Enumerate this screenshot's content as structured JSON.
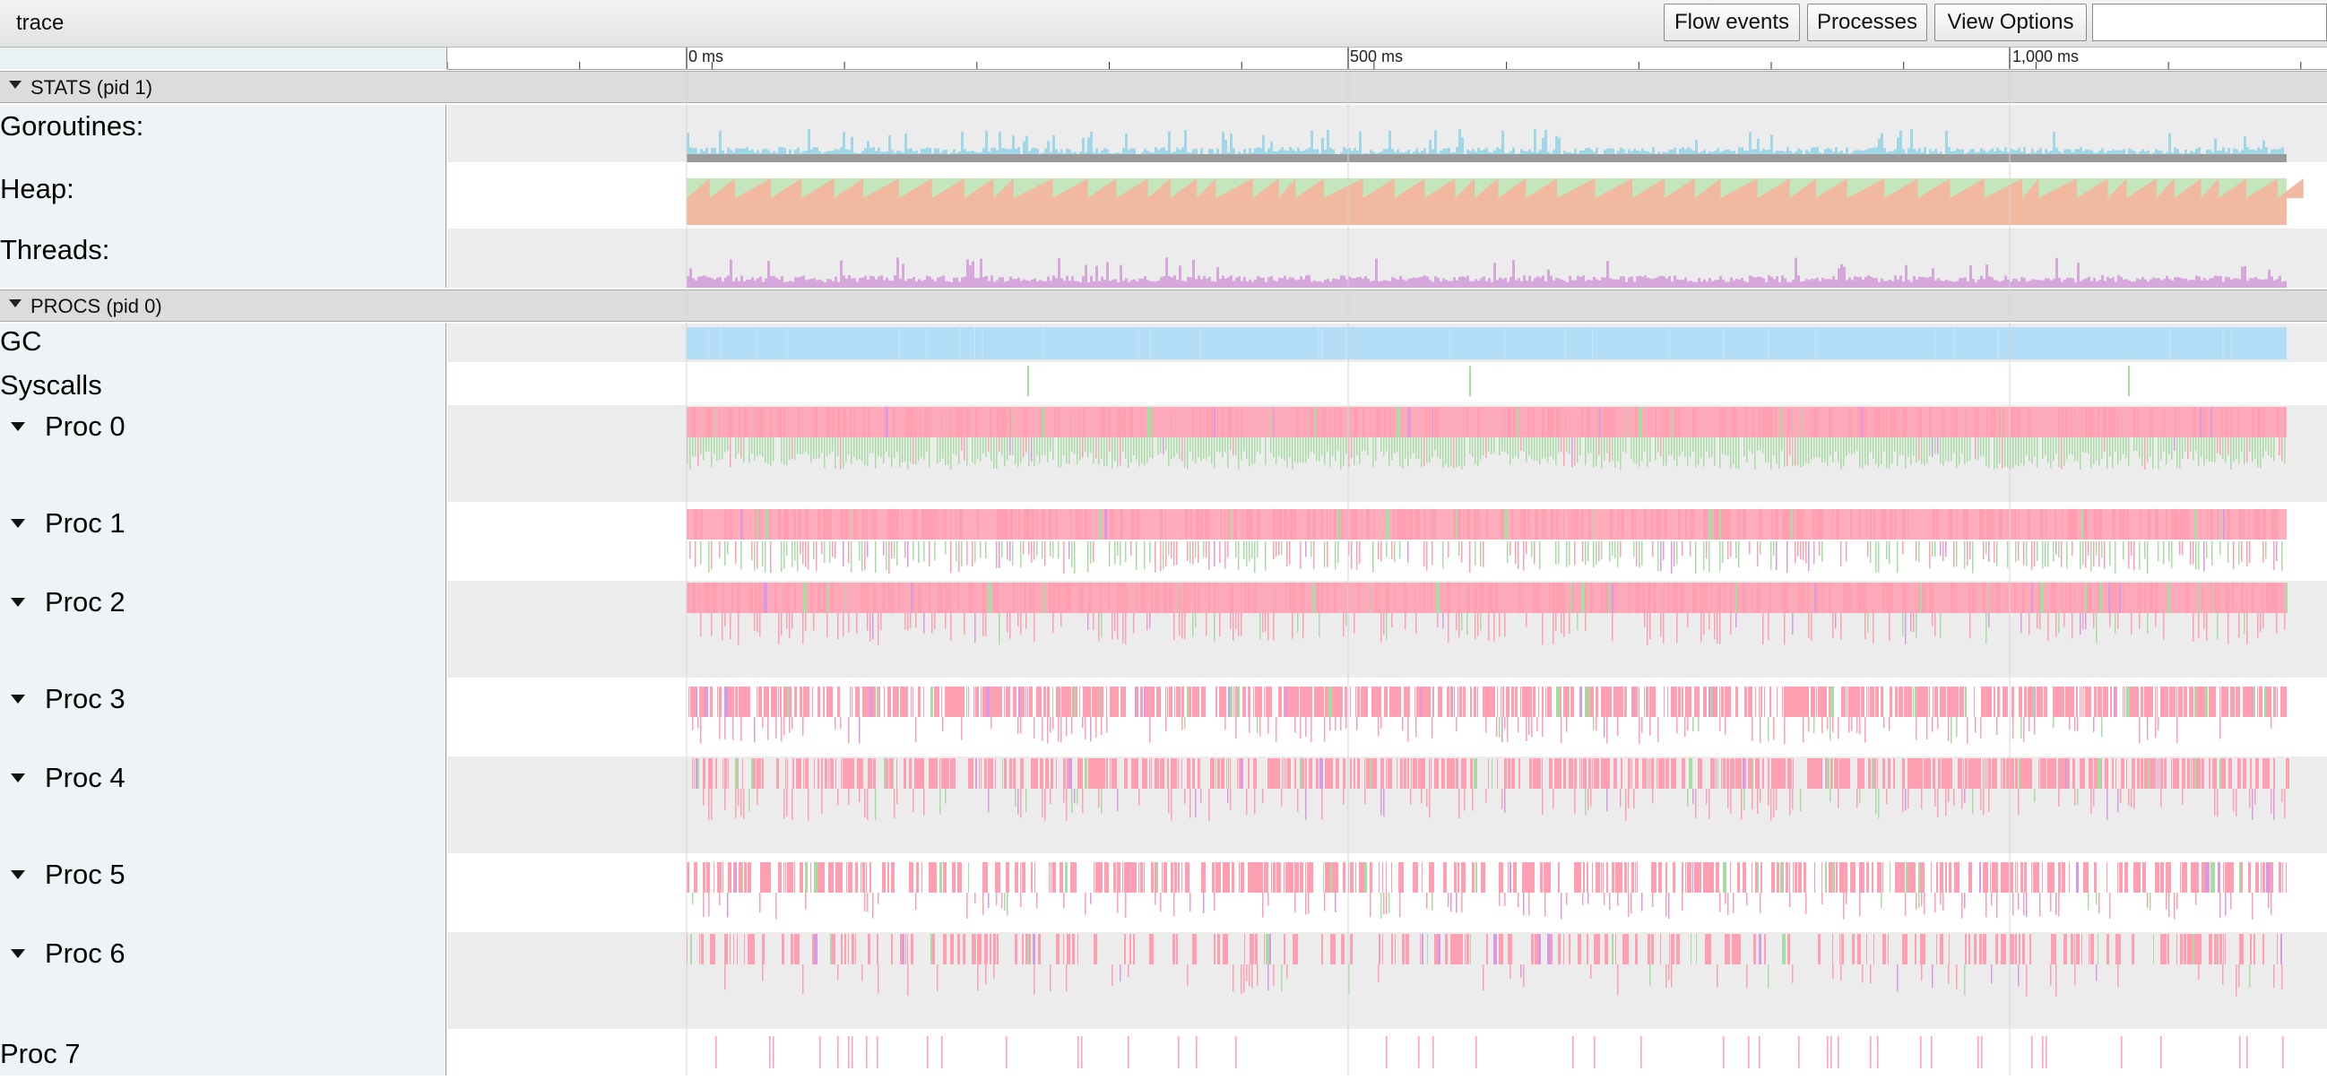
{
  "app": {
    "title": "trace"
  },
  "toolbar": {
    "flow_events": "Flow events",
    "processes": "Processes",
    "view_options": "View Options",
    "search_value": ""
  },
  "ruler": {
    "labels": [
      "0 ms",
      "500 ms",
      "1,000 ms"
    ]
  },
  "groups": {
    "stats": "STATS (pid 1)",
    "procs": "PROCS (pid 0)"
  },
  "stats_tracks": {
    "goroutines": "Goroutines:",
    "heap": "Heap:",
    "threads": "Threads:"
  },
  "procs_tracks": {
    "gc": "GC",
    "syscalls": "Syscalls",
    "proc0": "Proc 0",
    "proc1": "Proc 1",
    "proc2": "Proc 2",
    "proc3": "Proc 3",
    "proc4": "Proc 4",
    "proc5": "Proc 5",
    "proc6": "Proc 6",
    "proc7": "Proc 7"
  },
  "colors": {
    "goroutines_runnable": "#9fd6e8",
    "goroutines_running": "#9a9a9a",
    "heap_alloc": "#f0b9a0",
    "heap_next_gc": "#c4e6bd",
    "threads": "#d6a6dc",
    "gc": "#b3dcf6",
    "slice_pink": "#ff9fb1",
    "slice_green": "#a7dca2",
    "slice_purple": "#d79be4",
    "row_shade": "#ececec"
  }
}
